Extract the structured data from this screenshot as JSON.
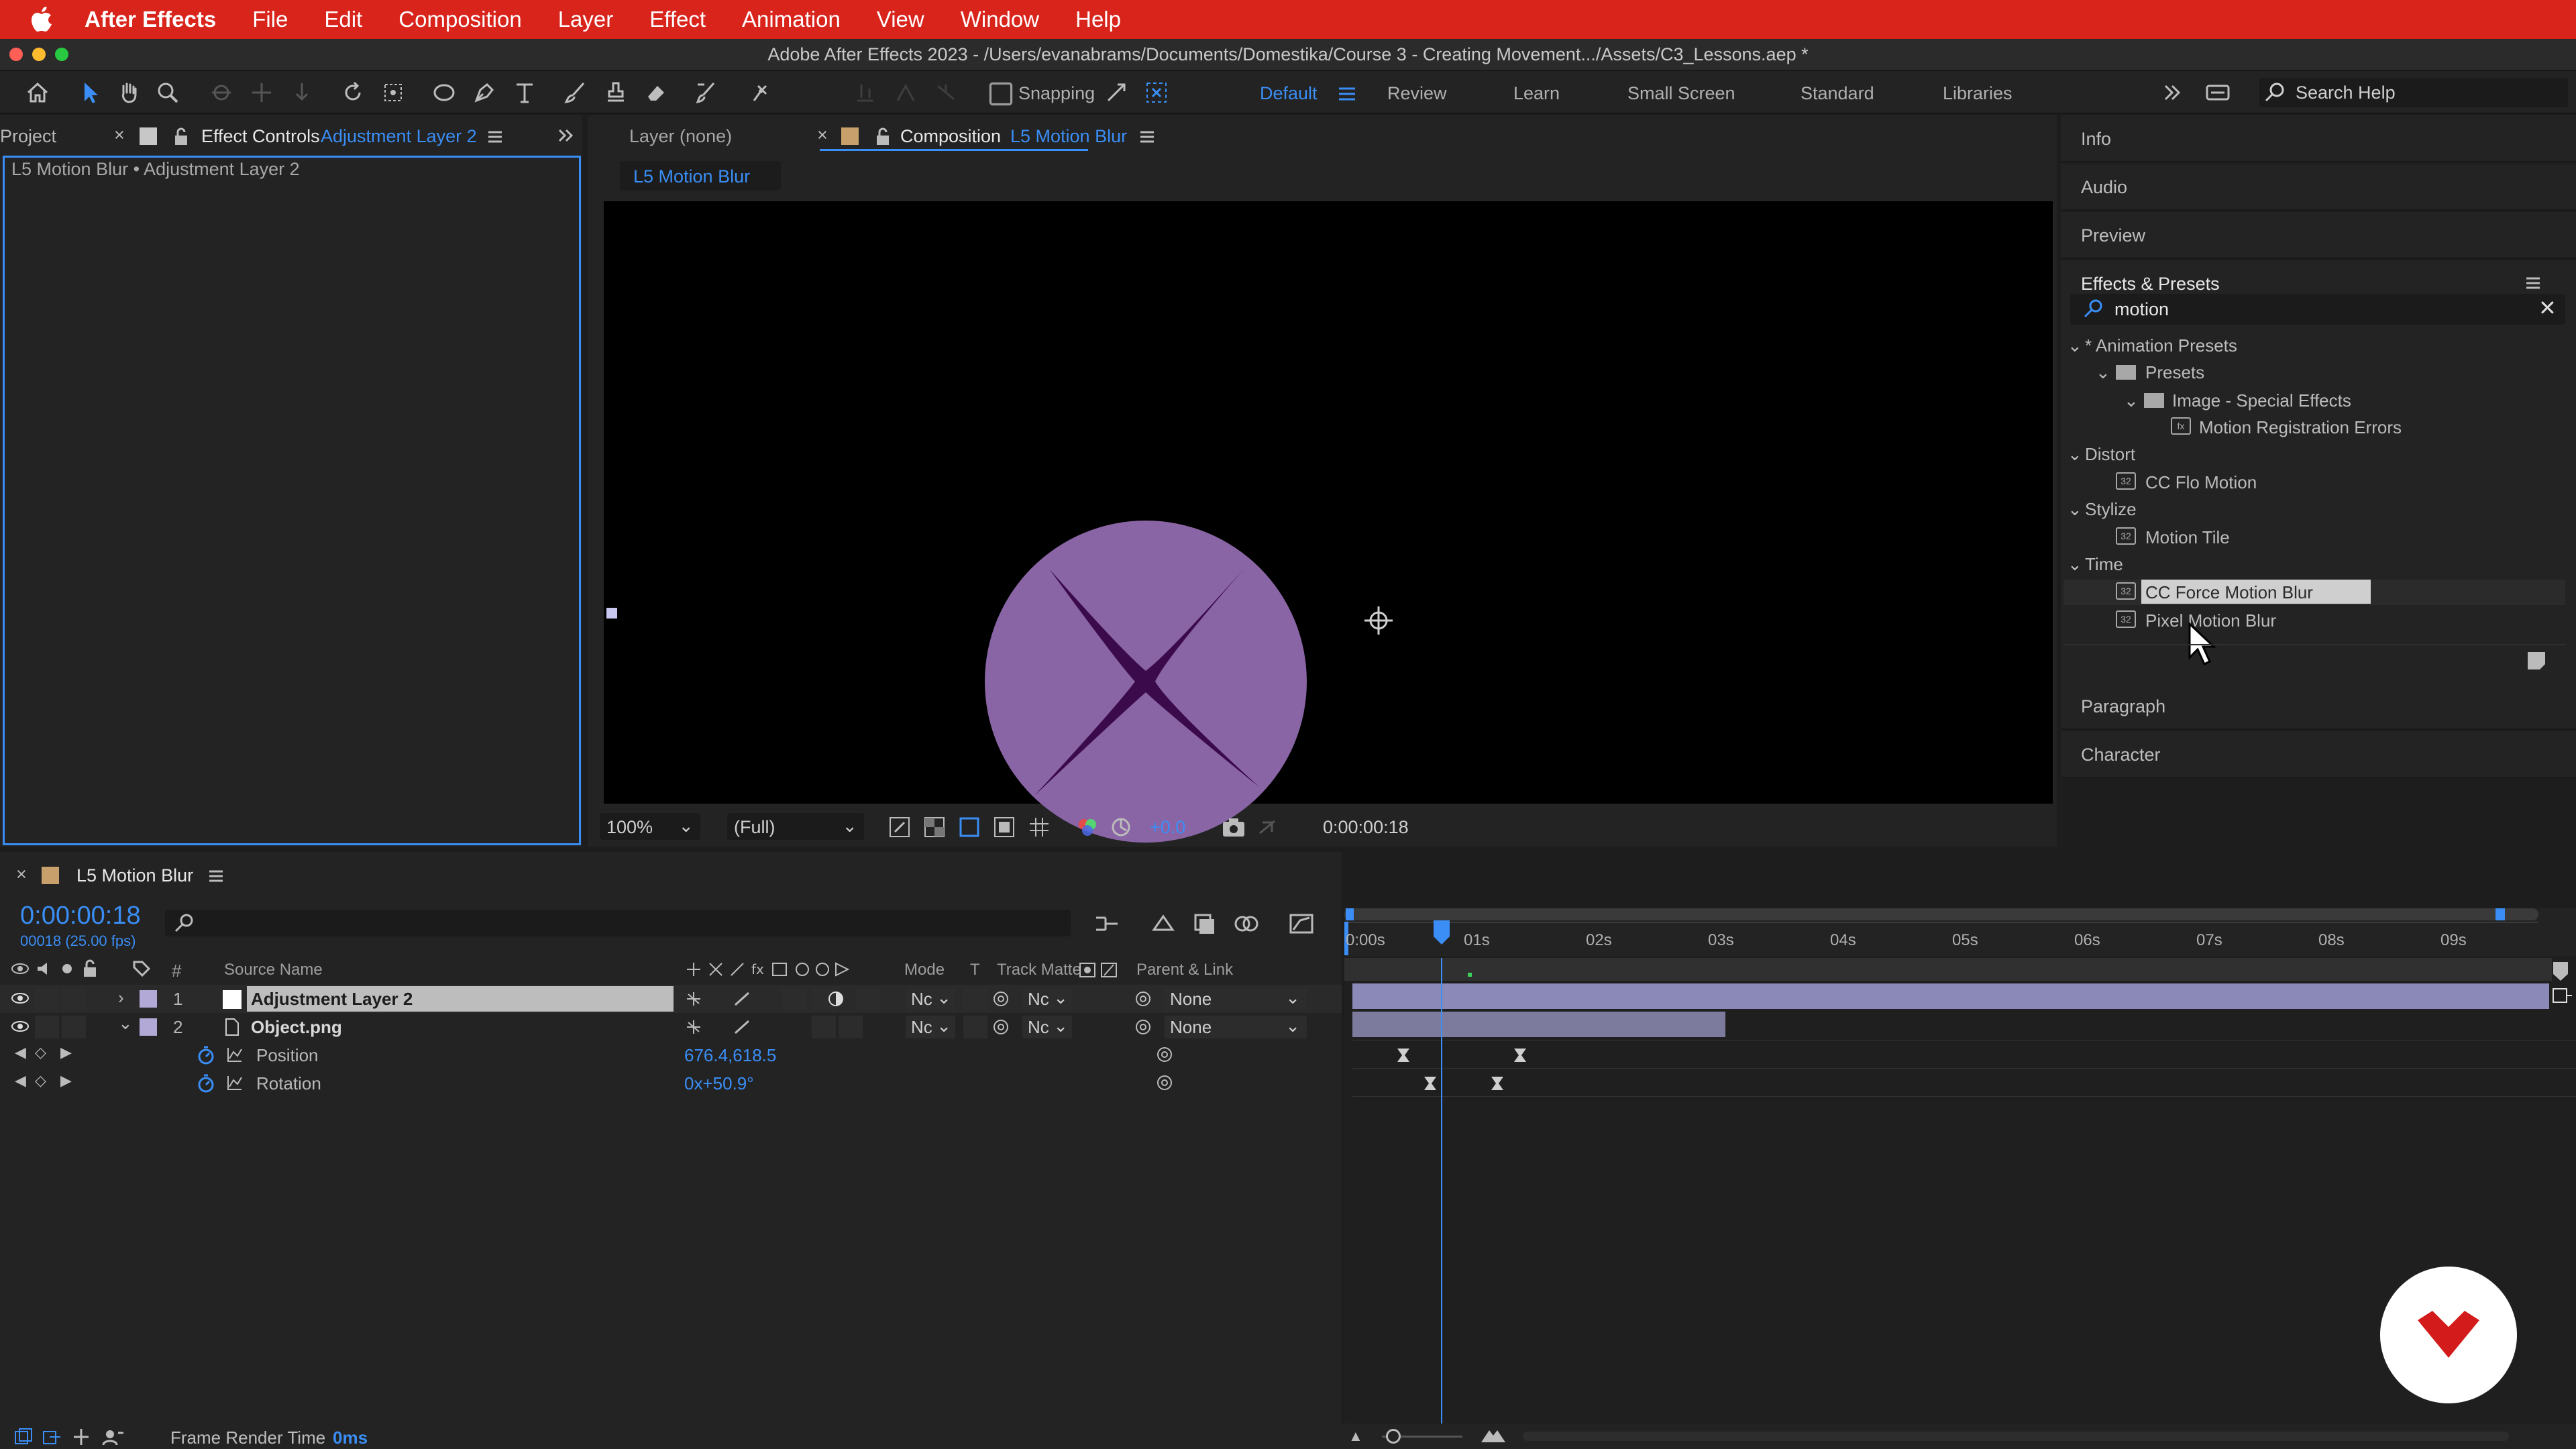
{
  "menubar": {
    "app_name": "After Effects",
    "items": [
      "File",
      "Edit",
      "Composition",
      "Layer",
      "Effect",
      "Animation",
      "View",
      "Window",
      "Help"
    ]
  },
  "window": {
    "title": "Adobe After Effects 2023 - /Users/evanabrams/Documents/Domestika/Course 3 - Creating Movement.../Assets/C3_Lessons.aep *"
  },
  "toolbar": {
    "snapping_label": "Snapping",
    "workspaces": [
      "Default",
      "Review",
      "Learn",
      "Small Screen",
      "Standard",
      "Libraries"
    ],
    "active_workspace": "Default",
    "search_placeholder": "Search Help"
  },
  "left_panel": {
    "project_tab": "Project",
    "effect_controls_tab": "Effect Controls",
    "effect_controls_layer": "Adjustment Layer 2",
    "breadcrumb": "L5 Motion Blur • Adjustment Layer 2"
  },
  "comp_panel": {
    "layer_tab": "Layer (none)",
    "composition_tab": "Composition",
    "composition_name": "L5 Motion Blur",
    "sub_tab": "L5 Motion Blur",
    "zoom": "100%",
    "resolution": "(Full)",
    "exposure": "+0.0",
    "timecode": "0:00:00:18"
  },
  "right_panel": {
    "info": "Info",
    "audio": "Audio",
    "preview": "Preview",
    "effects_presets": "Effects & Presets",
    "search_value": "motion",
    "tree": [
      {
        "label": "* Animation Presets",
        "depth": 0,
        "type": "group"
      },
      {
        "label": "Presets",
        "depth": 1,
        "type": "folder"
      },
      {
        "label": "Image - Special Effects",
        "depth": 2,
        "type": "folder"
      },
      {
        "label": "Motion Registration Errors",
        "depth": 3,
        "type": "preset"
      },
      {
        "label": "Distort",
        "depth": 0,
        "type": "group"
      },
      {
        "label": "CC Flo Motion",
        "depth": 1,
        "type": "effect"
      },
      {
        "label": "Stylize",
        "depth": 0,
        "type": "group"
      },
      {
        "label": "Motion Tile",
        "depth": 1,
        "type": "effect"
      },
      {
        "label": "Time",
        "depth": 0,
        "type": "group"
      },
      {
        "label": "CC Force Motion Blur",
        "depth": 1,
        "type": "effect",
        "selected": true
      },
      {
        "label": "Pixel Motion Blur",
        "depth": 1,
        "type": "effect"
      }
    ],
    "paragraph": "Paragraph",
    "character": "Character"
  },
  "timeline": {
    "tab_name": "L5 Motion Blur",
    "current_time": "0:00:00:18",
    "frame_info": "00018 (25.00 fps)",
    "columns": {
      "number": "#",
      "source_name": "Source Name",
      "mode": "Mode",
      "t": "T",
      "track_matte": "Track Matte",
      "parent_link": "Parent & Link"
    },
    "ruler": [
      "0:00s",
      "01s",
      "02s",
      "03s",
      "04s",
      "05s",
      "06s",
      "07s",
      "08s",
      "09s"
    ],
    "layers": [
      {
        "num": "1",
        "name": "Adjustment Layer 2",
        "mode": "Nc",
        "matte": "Nc",
        "parent": "None"
      },
      {
        "num": "2",
        "name": "Object.png",
        "mode": "Nc",
        "matte": "Nc",
        "parent": "None"
      }
    ],
    "properties": [
      {
        "name": "Position",
        "value": "676.4,618.5"
      },
      {
        "name": "Rotation",
        "value": "0x+50.9°"
      }
    ]
  },
  "statusbar": {
    "label": "Frame Render Time",
    "value": "0ms"
  },
  "colors": {
    "accent": "#3a8ef6",
    "menubar": "#d9241c",
    "circle": "#8a65a6",
    "star": "#3b0a4a",
    "layer_bar": "#8b89b8"
  }
}
